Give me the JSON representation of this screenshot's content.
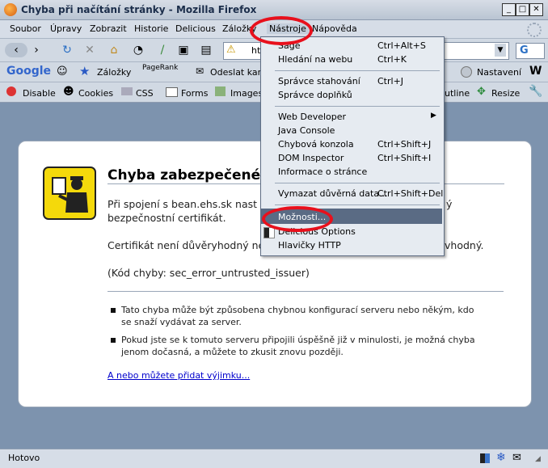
{
  "window": {
    "title": "Chyba při načítání stránky - Mozilla Firefox"
  },
  "menubar": {
    "items": [
      "Soubor",
      "Úpravy",
      "Zobrazit",
      "Historie",
      "Delicious",
      "Záložky",
      "Nástroje",
      "Nápověda"
    ]
  },
  "navbar": {
    "url_partial": "htt"
  },
  "googlebar": {
    "logo": "Google",
    "zalozky": "Záložky",
    "pagerank": "PageRank",
    "odeslat": "Odeslat kam",
    "nastaveni": "Nastavení"
  },
  "devbar": {
    "disable": "Disable",
    "cookies": "Cookies",
    "css": "CSS",
    "forms": "Forms",
    "images": "Images",
    "outline": "utline",
    "resize": "Resize"
  },
  "error": {
    "title": "Chyba zabezpečeného",
    "p1a": "Při spojení s bean.ehs.sk nast",
    "p1b": "bezpečnostní certifikát.",
    "p1tail": "ý",
    "p2a": "Certifikát není důvěryhodný ne",
    "p2tail": "vhodný.",
    "code": "(Kód chyby: sec_error_untrusted_issuer)",
    "bullet1": "Tato chyba může být způsobena chybnou konfigurací serveru nebo někým, kdo se snaží vydávat za server.",
    "bullet2": "Pokud jste se k tomuto serveru připojili úspěšně již v minulosti, je možná chyba jenom dočasná, a můžete to zkusit znovu později.",
    "link": "A nebo můžete přidat výjimku..."
  },
  "status": {
    "text": "Hotovo"
  },
  "dropdown": {
    "items": [
      {
        "label": "Sage",
        "shortcut": "Ctrl+Alt+S"
      },
      {
        "label": "Hledání na webu",
        "shortcut": "Ctrl+K"
      },
      {
        "label": "Správce stahování",
        "shortcut": "Ctrl+J"
      },
      {
        "label": "Správce doplňků",
        "shortcut": ""
      },
      {
        "label": "Web Developer",
        "shortcut": ""
      },
      {
        "label": "Java Console",
        "shortcut": ""
      },
      {
        "label": "Chybová konzola",
        "shortcut": "Ctrl+Shift+J"
      },
      {
        "label": "DOM Inspector",
        "shortcut": "Ctrl+Shift+I"
      },
      {
        "label": "Informace o stránce",
        "shortcut": ""
      },
      {
        "label": "Vymazat důvěrná data...",
        "shortcut": "Ctrl+Shift+Del"
      },
      {
        "label": "Možnosti...",
        "shortcut": ""
      },
      {
        "label": "Delicious Options",
        "shortcut": ""
      },
      {
        "label": "Hlavičky HTTP",
        "shortcut": ""
      }
    ]
  },
  "colors": {
    "highlight": "#e8101c",
    "menu_hover": "#5a6b84",
    "link": "#0000cc"
  }
}
